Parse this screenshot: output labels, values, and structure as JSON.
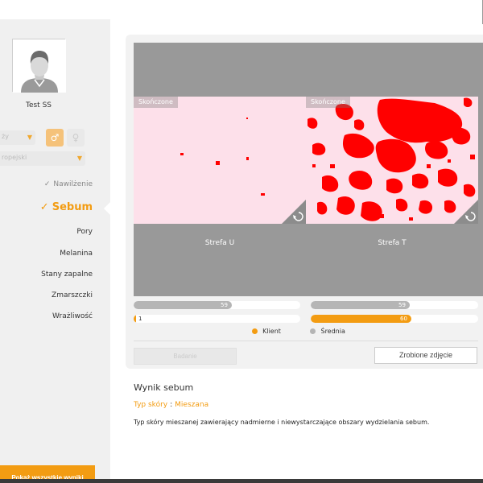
{
  "user": {
    "name": "Test SS"
  },
  "filters": {
    "gender_select_text": "ży",
    "ethnic_select_text": "ropejski"
  },
  "menu": {
    "items": [
      {
        "label": "Nawilżenie",
        "state": "done"
      },
      {
        "label": "Sebum",
        "state": "active"
      },
      {
        "label": "Pory",
        "state": "normal"
      },
      {
        "label": "Melanina",
        "state": "normal"
      },
      {
        "label": "Stany zapalne",
        "state": "normal"
      },
      {
        "label": "Zmarszczki",
        "state": "normal"
      },
      {
        "label": "Wrażliwość",
        "state": "normal"
      }
    ],
    "show_all_label": "Pokaż wszystkie wyniki"
  },
  "zones": {
    "u": {
      "tag": "Skończone",
      "label": "Strefa U"
    },
    "t": {
      "tag": "Skończone",
      "label": "Strefa T"
    }
  },
  "scores": {
    "u": {
      "average": 59,
      "client": 1
    },
    "t": {
      "average": 59,
      "client": 60
    }
  },
  "legend": {
    "client": "Klient",
    "average": "Średnia"
  },
  "buttons": {
    "exam": "Badanie",
    "photo": "Zrobione zdjęcie"
  },
  "result": {
    "title": "Wynik sebum",
    "type_label": "Typ skóry",
    "type_sep": ":",
    "type_value": "Mieszana",
    "description": "Typ skóry mieszanej zawierający nadmierne i niewystarczające obszary wydzielania sebum."
  },
  "colors": {
    "accent": "#f39c12",
    "sebum_spot": "#ff0000",
    "zone_bg": "#fde0ea"
  }
}
